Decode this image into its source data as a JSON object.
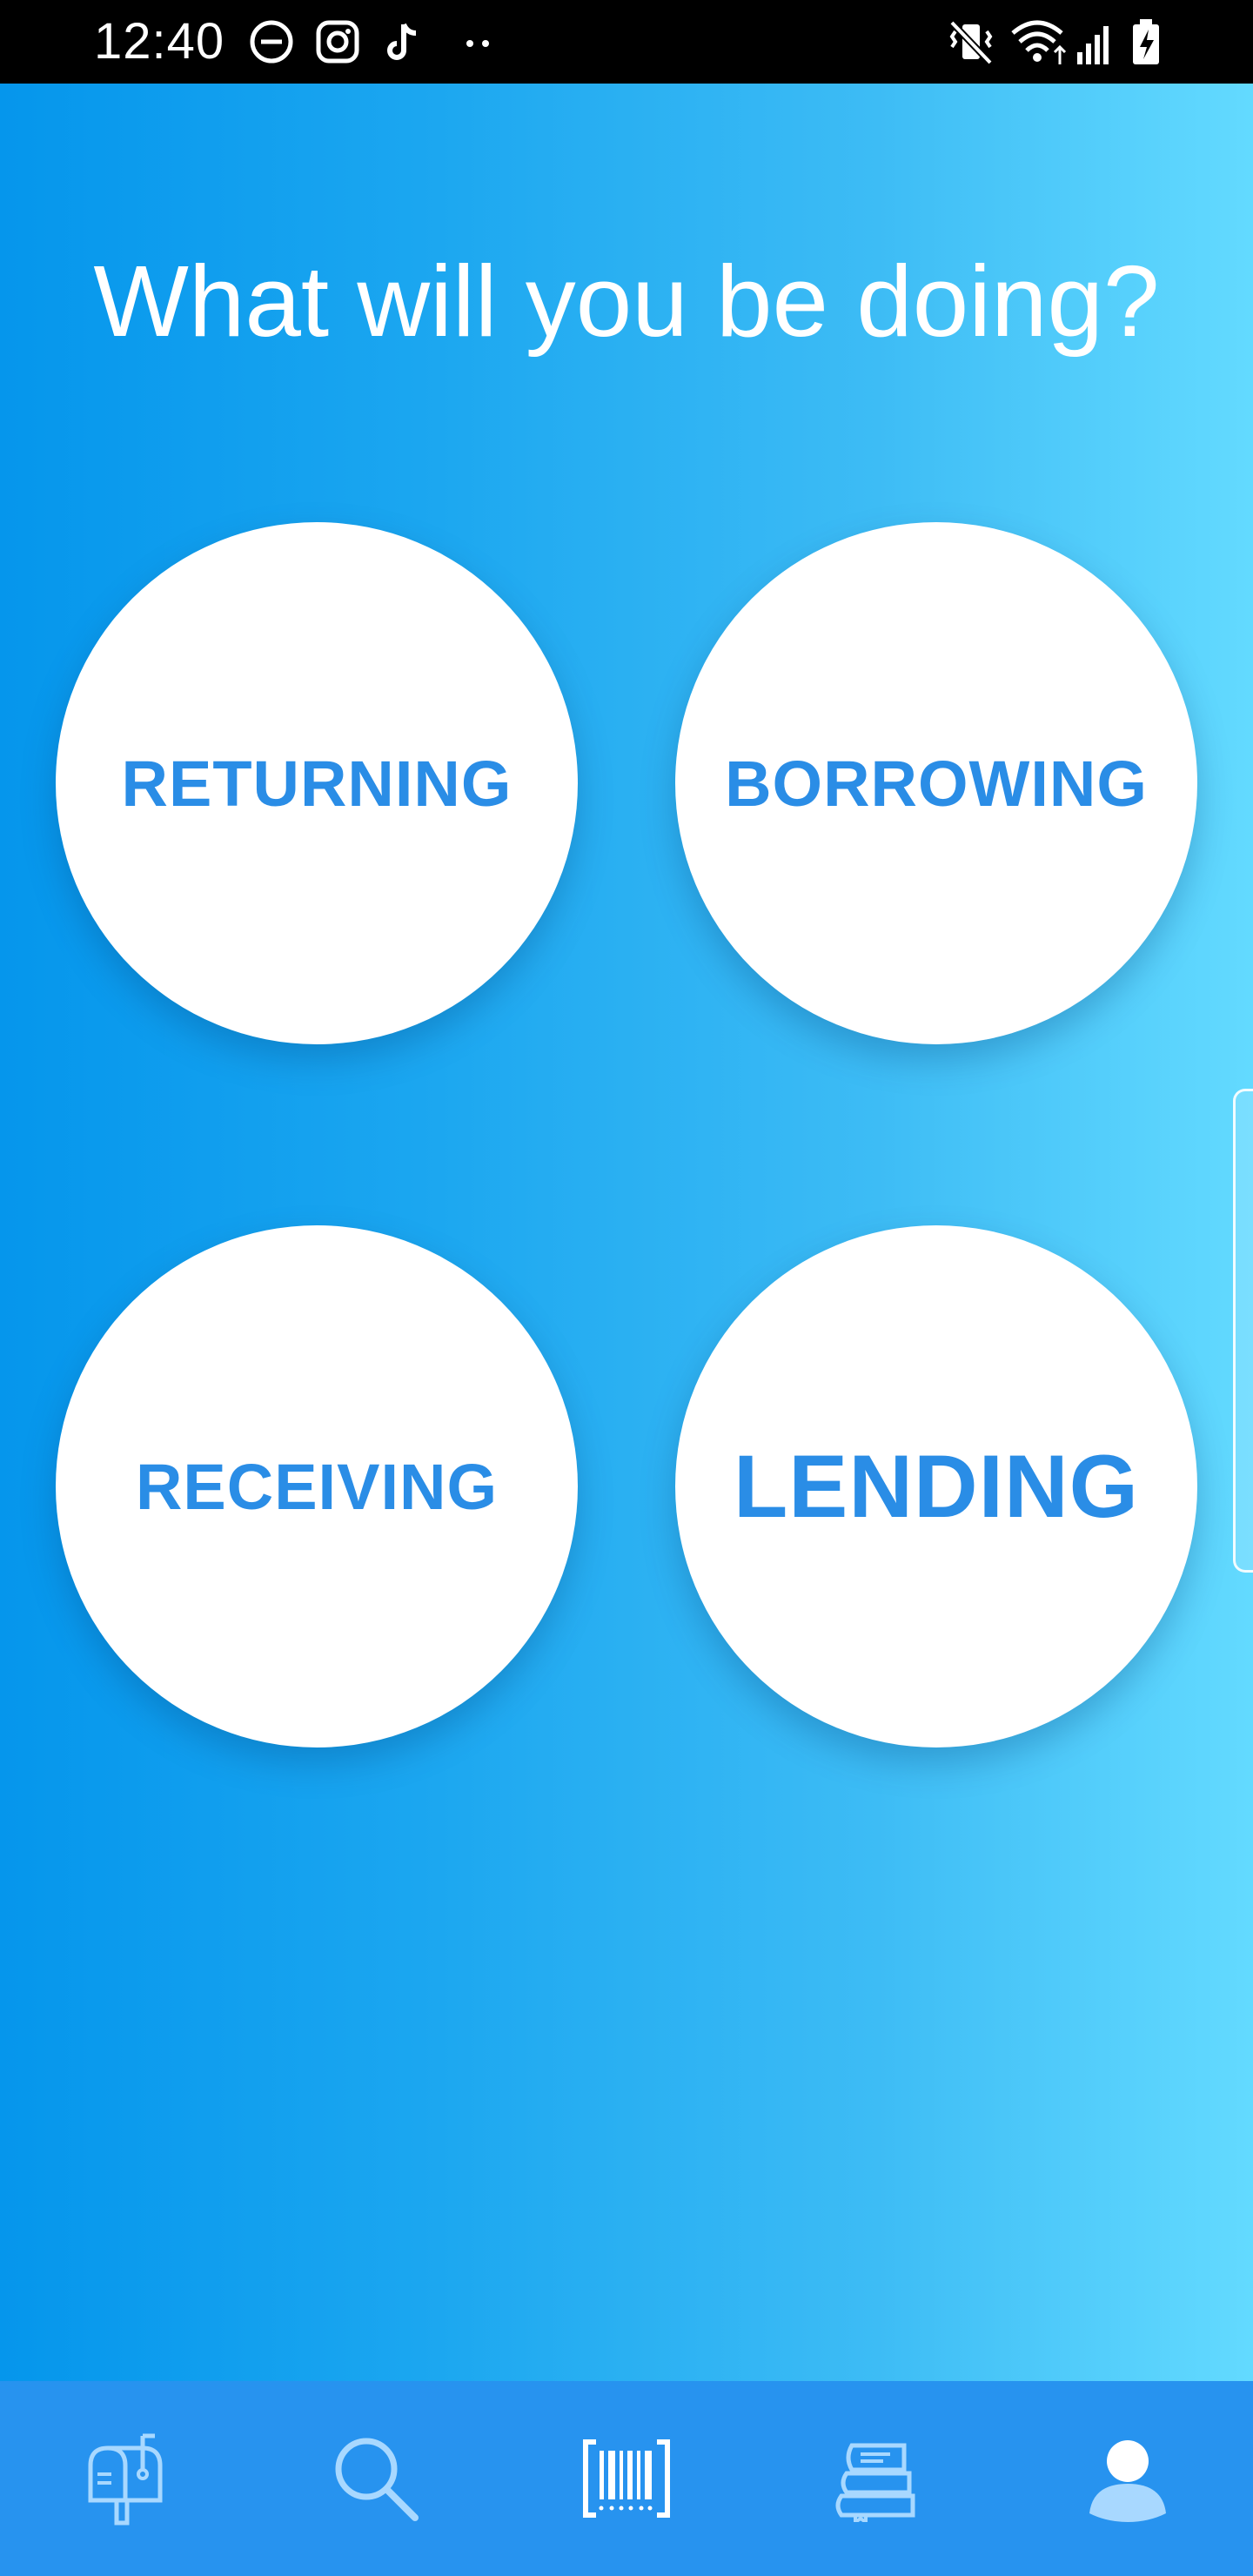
{
  "status_bar": {
    "time": "12:40",
    "icons": [
      "do-not-disturb-icon",
      "instagram-icon",
      "tiktok-icon",
      "more-notifications-icon",
      "vibrate-icon",
      "wifi-icon",
      "signal-icon",
      "battery-charging-icon"
    ]
  },
  "main": {
    "title": "What will you be doing?",
    "choices": [
      {
        "label": "RETURNING"
      },
      {
        "label": "BORROWING"
      },
      {
        "label": "RECEIVING"
      },
      {
        "label": "LENDING"
      }
    ]
  },
  "bottom_nav": {
    "items": [
      {
        "icon": "mailbox-icon"
      },
      {
        "icon": "search-icon"
      },
      {
        "icon": "barcode-scan-icon"
      },
      {
        "icon": "books-icon"
      },
      {
        "icon": "profile-icon"
      }
    ]
  },
  "colors": {
    "gradient_start": "#0596ec",
    "gradient_end": "#63daff",
    "button_text": "#2a8de6",
    "nav_background": "#2793ef",
    "nav_icon": "#a8d8ff"
  }
}
